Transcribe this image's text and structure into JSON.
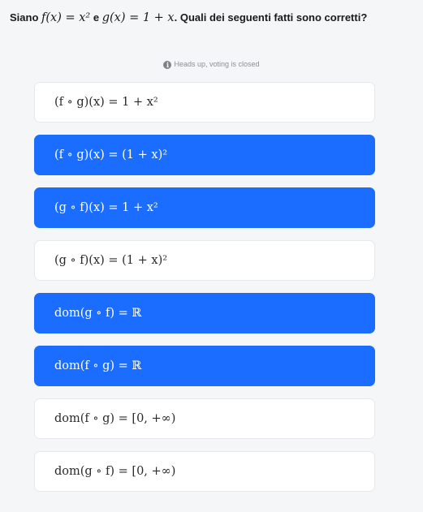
{
  "question": {
    "prefix": "Siano ",
    "f_def": "f(x) = x²",
    "conj": " e ",
    "g_def": "g(x) = 1 + x",
    "suffix": ". Quali dei seguenti fatti sono corretti?"
  },
  "notice": {
    "icon": "info-icon",
    "text": "Heads up, voting is closed"
  },
  "options": [
    {
      "label": "(f ∘ g)(x) = 1 + x²",
      "selected": false
    },
    {
      "label": "(f ∘ g)(x) = (1 + x)²",
      "selected": true
    },
    {
      "label": "(g ∘ f)(x) = 1 + x²",
      "selected": true
    },
    {
      "label": "(g ∘ f)(x) = (1 + x)²",
      "selected": false
    },
    {
      "label": "dom(g ∘ f) = ℝ",
      "selected": true
    },
    {
      "label": "dom(f ∘ g) = ℝ",
      "selected": true
    },
    {
      "label": "dom(f ∘ g) = [0, +∞)",
      "selected": false
    },
    {
      "label": "dom(g ∘ f) = [0, +∞)",
      "selected": false
    }
  ],
  "colors": {
    "selected_bg": "#1a6dff",
    "unselected_bg": "#ffffff",
    "page_bg": "#f5f6f8"
  }
}
